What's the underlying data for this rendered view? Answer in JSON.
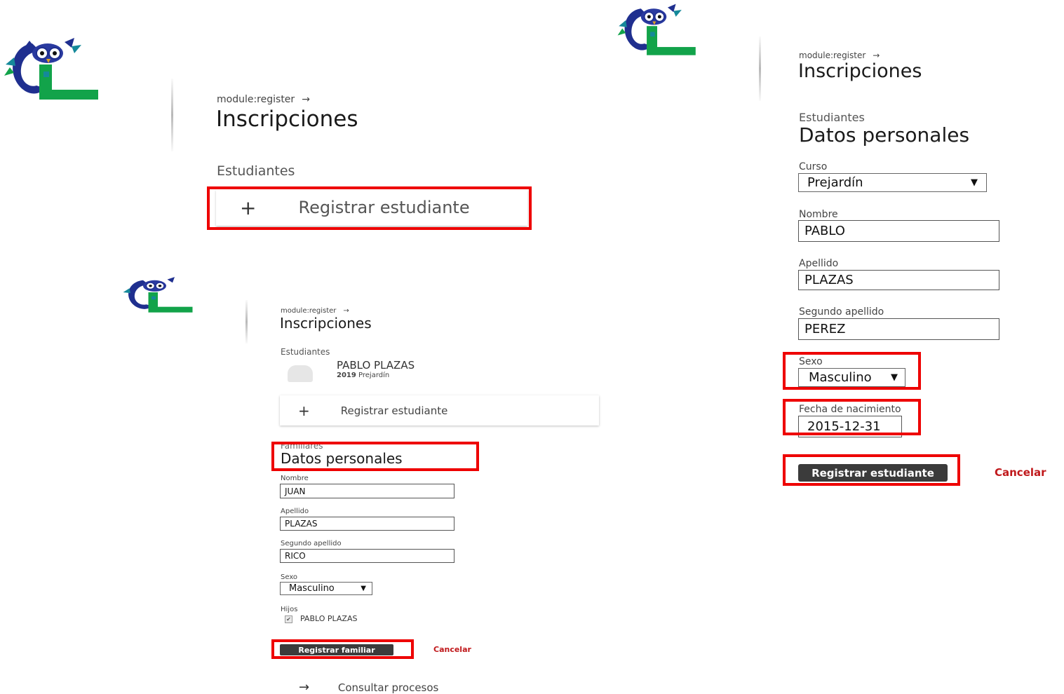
{
  "logo": {
    "alt": "GL owl school logo",
    "letters": "GL",
    "colors": {
      "blue": "#1f2f8f",
      "green": "#12a34a",
      "teal": "#15899a"
    }
  },
  "accent": {
    "highlight": "#ee0000",
    "cancel": "#c0181b",
    "button": "#3b3b3b"
  },
  "panel1": {
    "breadcrumb": "module:register",
    "arrow": "→",
    "title": "Inscripciones",
    "section": "Estudiantes",
    "register_icon": "+",
    "register_label": "Registrar estudiante"
  },
  "panel2": {
    "breadcrumb": "module:register",
    "arrow": "→",
    "title": "Inscripciones",
    "section": "Estudiantes",
    "subtitle": "Datos personales",
    "curso_label": "Curso",
    "curso_value": "Prejardín",
    "nombre_label": "Nombre",
    "nombre_value": "PABLO",
    "apellido_label": "Apellido",
    "apellido_value": "PLAZAS",
    "segundo_label": "Segundo apellido",
    "segundo_value": "PEREZ",
    "sexo_label": "Sexo",
    "sexo_value": "Masculino",
    "fecha_label": "Fecha de nacimiento",
    "fecha_value": "2015-12-31",
    "submit_label": "Registrar estudiante",
    "cancel_label": "Cancelar"
  },
  "panel3": {
    "breadcrumb": "module:register",
    "arrow": "→",
    "title": "Inscripciones",
    "section": "Estudiantes",
    "student_name": "PABLO PLAZAS",
    "student_year": "2019",
    "student_course": "Prejardín",
    "register_icon": "+",
    "register_label": "Registrar estudiante",
    "family_section": "Familiares",
    "subtitle": "Datos personales",
    "nombre_label": "Nombre",
    "nombre_value": "JUAN",
    "apellido_label": "Apellido",
    "apellido_value": "PLAZAS",
    "segundo_label": "Segundo apellido",
    "segundo_value": "RICO",
    "sexo_label": "Sexo",
    "sexo_value": "Masculino",
    "hijos_label": "Hijos",
    "hijo_name": "PABLO PLAZAS",
    "submit_label": "Registrar familiar",
    "cancel_label": "Cancelar",
    "consult_icon": "→",
    "consult_label": "Consultar procesos"
  }
}
